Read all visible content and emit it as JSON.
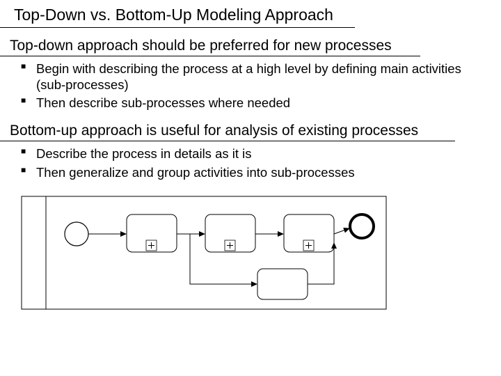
{
  "title": "Top-Down vs. Bottom-Up Modeling Approach",
  "sections": [
    {
      "heading": "Top-down approach should be preferred for new processes",
      "bullets": [
        "Begin with describing the process at a high level by defining main activities (sub-processes)",
        "Then describe sub-processes where needed"
      ]
    },
    {
      "heading": "Bottom-up approach is useful for analysis of existing processes",
      "bullets": [
        "Describe the process in details as it is",
        "Then generalize and group activities into sub-processes"
      ]
    }
  ]
}
